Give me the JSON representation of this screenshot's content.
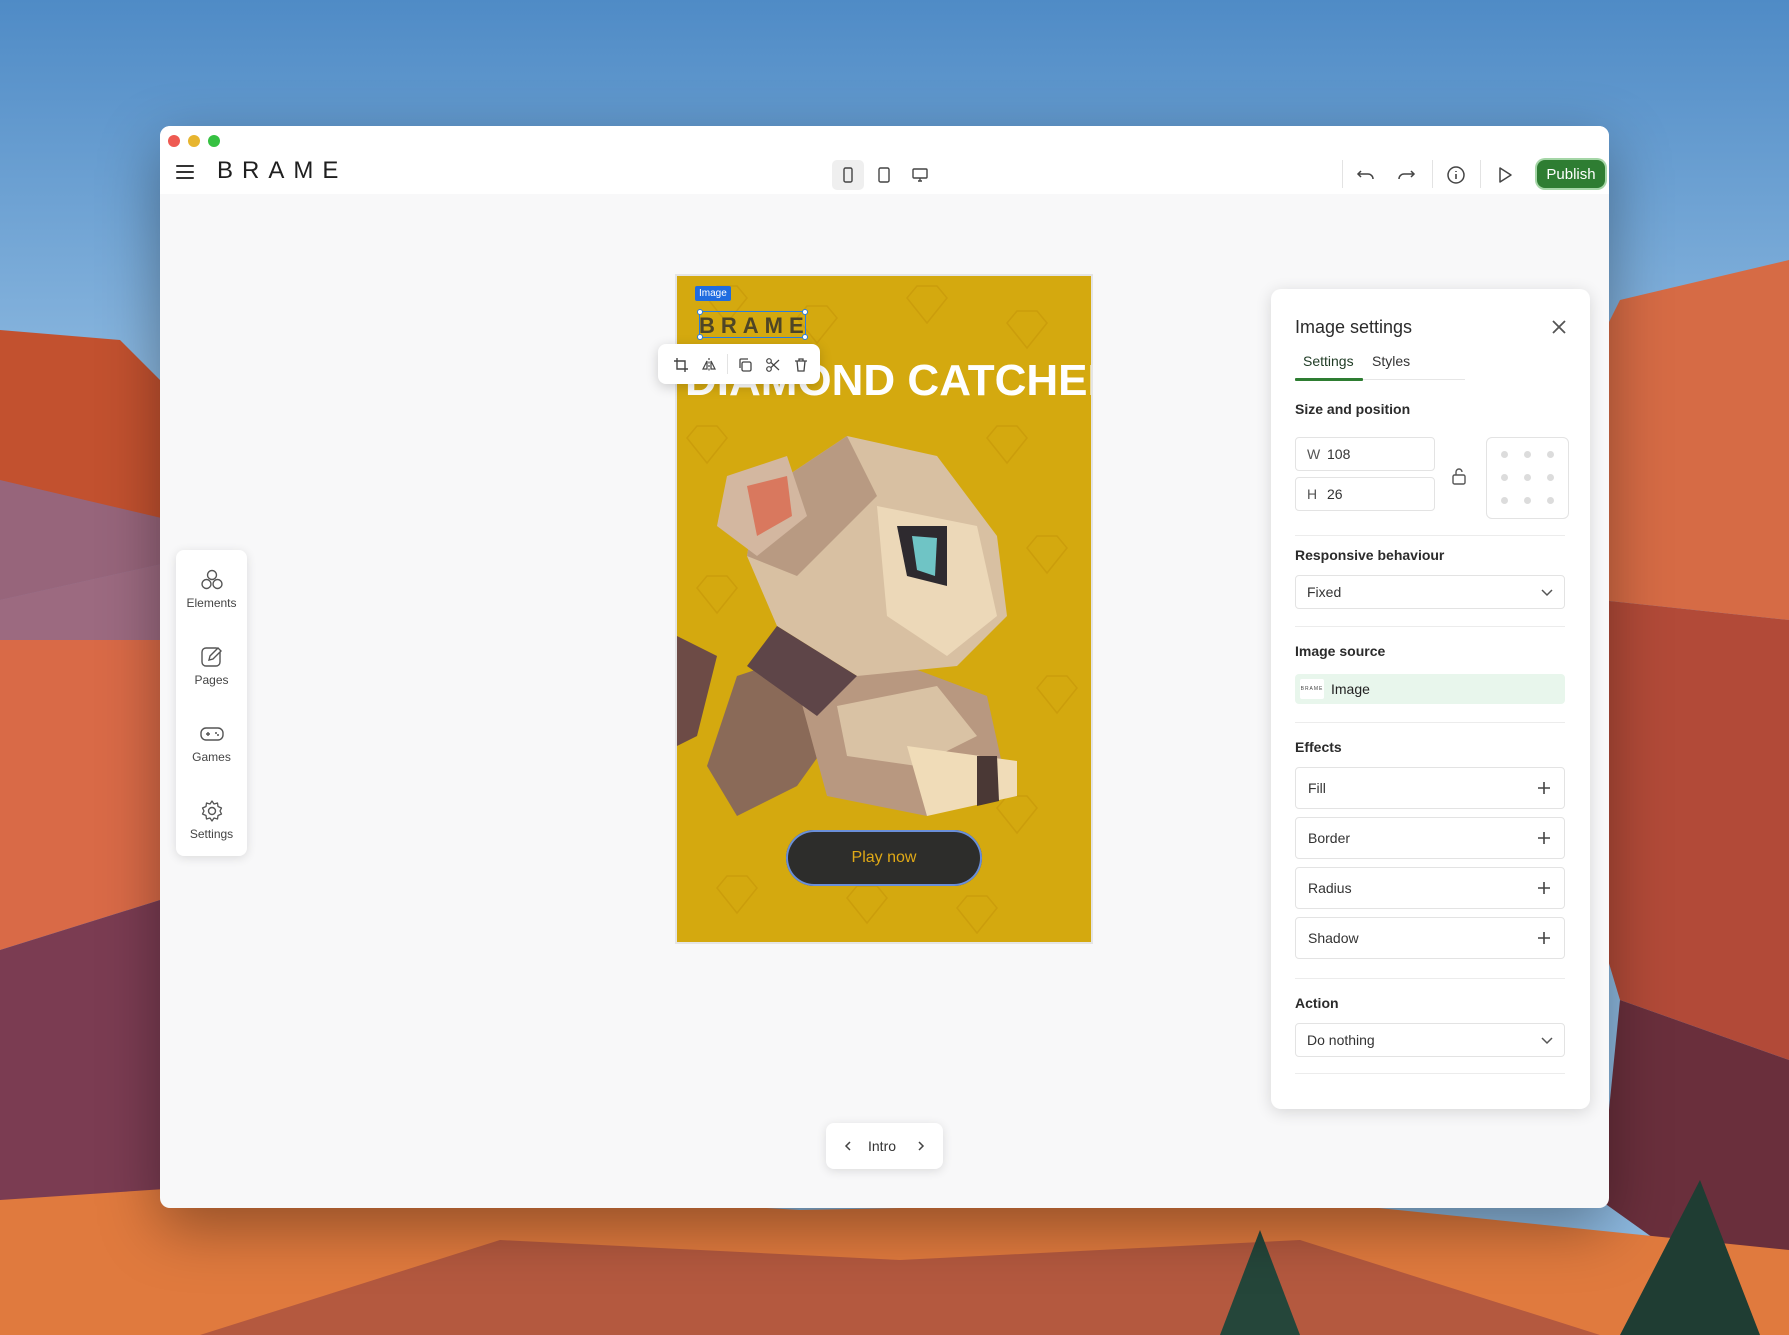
{
  "app": {
    "logo": "BRAME",
    "publish_label": "Publish"
  },
  "sidebar": {
    "items": [
      {
        "label": "Elements",
        "icon": "elements-icon"
      },
      {
        "label": "Pages",
        "icon": "pages-icon"
      },
      {
        "label": "Games",
        "icon": "gamepad-icon"
      },
      {
        "label": "Settings",
        "icon": "gear-icon"
      }
    ]
  },
  "canvas": {
    "selection_tag": "Image",
    "logo_image_text": "BRAME",
    "title": "DIAMOND CATCHER",
    "button_label": "Play now",
    "bg_color": "#d4a90f"
  },
  "pager": {
    "current_page": "Intro"
  },
  "panel": {
    "title": "Image settings",
    "tabs": [
      "Settings",
      "Styles"
    ],
    "size_section": "Size and position",
    "width_prefix": "W",
    "width_value": "108",
    "height_prefix": "H",
    "height_value": "26",
    "responsive_section": "Responsive behaviour",
    "responsive_value": "Fixed",
    "source_section": "Image source",
    "source_thumb_text": "BRAME",
    "source_value": "Image",
    "effects_section": "Effects",
    "effects": [
      "Fill",
      "Border",
      "Radius",
      "Shadow"
    ],
    "action_section": "Action",
    "action_value": "Do nothing"
  },
  "colors": {
    "accent": "#2e7d32",
    "selection": "#2a7de1"
  }
}
